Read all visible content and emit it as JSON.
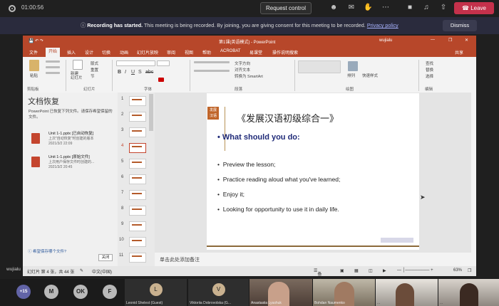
{
  "teams": {
    "timer": "01:00:56",
    "request_control": "Request control",
    "leave": "Leave",
    "banner_title": "Recording has started.",
    "banner_text": "This meeting is being recorded. By joining, you are giving consent for this meeting to be recorded.",
    "banner_link": "Privacy policy",
    "dismiss": "Dismiss",
    "presenter_name": "wujialu"
  },
  "ppt": {
    "window_title": "第1课(英语模式) - PowerPoint",
    "user": "wujialu",
    "share": "共享",
    "tabs": [
      "文件",
      "开始",
      "插入",
      "设计",
      "切换",
      "动画",
      "幻灯片放映",
      "审阅",
      "视图",
      "帮助",
      "ACROBAT",
      "易课堂",
      "操作说明搜索"
    ],
    "active_tab": "开始",
    "ribbon_groups": [
      "剪贴板",
      "幻灯片",
      "字体",
      "段落",
      "绘图",
      "编辑"
    ],
    "ribbon_items": {
      "paste": "粘贴",
      "new_slide": "新建\n幻灯片",
      "layout": "版式",
      "reset": "重置",
      "section": "节",
      "text_direction": "文字方向",
      "align_text": "对齐文本",
      "smartart": "转换为 SmartArt",
      "arrange": "排列",
      "quick_styles": "快速样式",
      "find": "查找",
      "replace": "替换",
      "select": "选择"
    },
    "recovery": {
      "title": "文档恢复",
      "desc": "PowerPoint 已恢复下列文件。请保存希望保留的文件。",
      "items": [
        {
          "name": "Unit 1-1.pptx  [已自动恢复]",
          "info": "上次\"自动恢复\"时创建的版本",
          "date": "2021/3/2 22:09"
        },
        {
          "name": "Unit 1-1.pptx  [原始文件]",
          "info": "上次用户保存文件时创建的...",
          "date": "2021/3/2 20:45"
        }
      ],
      "help_link": "希望保存哪个文件?",
      "close": "关闭"
    },
    "slide_numbers": [
      "1",
      "2",
      "3",
      "4",
      "5",
      "6",
      "7",
      "8",
      "9",
      "10",
      "11"
    ],
    "selected_slide": "4",
    "slide": {
      "logo": "发展\n汉语",
      "title": "《发展汉语初级综合一》",
      "heading": "What should you do:",
      "bullets": [
        "Preview the lesson;",
        "Practice reading aloud what you've learned;",
        "Enjoy it;",
        "Looking for opportunity to use it in daily life."
      ]
    },
    "notes_placeholder": "单击此处添加备注",
    "status": {
      "slide_info": "幻灯片 第 4 张，共 44 张",
      "language": "中文(中国)",
      "notes": "备注",
      "zoom": "63%"
    }
  },
  "participants": {
    "overflow": "+15",
    "avatars": [
      {
        "initial": "M",
        "color": "#b9b9b9"
      },
      {
        "initial": "OK",
        "color": "#b9b9b9"
      },
      {
        "initial": "F",
        "color": "#b9b9b9"
      }
    ],
    "tiles": [
      {
        "initial": "L",
        "name": "Leonid Shelest (Guest)"
      },
      {
        "initial": "V",
        "name": "Viktoriia Dobrovolska (G..."
      }
    ],
    "videos": [
      {
        "name": "Anastasiia Lyashuk"
      },
      {
        "name": "Bohdan Naumenko"
      },
      {
        "name": "..."
      },
      {
        "name": "..."
      }
    ]
  }
}
